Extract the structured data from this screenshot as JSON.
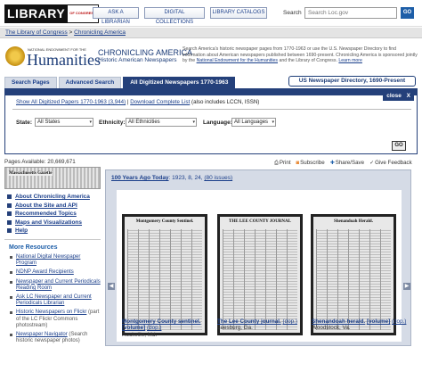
{
  "header": {
    "logo_word": "LIBRARY",
    "logo_sub": "OF CONGRESS",
    "buttons": [
      "ASK A LIBRARIAN",
      "DIGITAL COLLECTIONS",
      "LIBRARY CATALOGS"
    ],
    "search_label": "Search",
    "search_placeholder": "Search Loc.gov",
    "go_label": "GO"
  },
  "breadcrumb": [
    "The Library of Congress",
    ">",
    "Chronicling America"
  ],
  "banner": {
    "neh_small": "NATIONAL ENDOWMENT FOR THE",
    "neh_big": "Humanities",
    "title": "CHRONICLING AMERICA",
    "subtitle": "Historic American Newspapers",
    "desc_1": "Search America's historic newspaper pages from 1770-1963 or use the U.S. Newspaper Directory to find information about American newspapers published between 1690-present. Chronicling America is sponsored jointly by the",
    "desc_link_1": "National Endowment for the Humanities",
    "desc_2": "and the Library of Congress.",
    "desc_link_2": "Learn more"
  },
  "tabs": [
    "Search Pages",
    "Advanced Search",
    "All Digitized Newspapers 1770-1963"
  ],
  "directory_button": "US Newspaper Directory, 1690-Present",
  "panel": {
    "close_label": "close",
    "close_x": "X",
    "link_show_all": "Show All Digitized Papers 1770-1963 (3,944)",
    "separator": "|",
    "link_download": "Download Complete List",
    "download_note": "(also includes LCCN, ISSN)",
    "state_label": "State:",
    "state_value": "All States",
    "ethnicity_label": "Ethnicity:",
    "ethnicity_value": "All Ethnicities",
    "language_label": "Language:",
    "language_value": "All Languages",
    "go_label": "GO"
  },
  "pages_available": "Pages Available: 20,669,671",
  "share": [
    "Print",
    "Subscribe",
    "Share/Save",
    "Give Feedback"
  ],
  "sidebar": {
    "image_text": "Massachusetts Gazette",
    "nav": [
      "About Chronicling America",
      "About the Site and API",
      "Recommended Topics",
      "Maps and Visualizations",
      "Help"
    ],
    "more_heading": "More Resources",
    "resources": [
      {
        "link": "National Digital Newspaper Program",
        "note": ""
      },
      {
        "link": "NDNP Award Recipients",
        "note": ""
      },
      {
        "link": "Newspaper and Current Periodicals Reading Room",
        "note": ""
      },
      {
        "link": "Ask LC Newspaper and Current Periodicals Librarian",
        "note": ""
      },
      {
        "link": "Historic Newspapers on Flickr",
        "note": "(part of the LC Flickr Commons photostream)"
      },
      {
        "link": "Newspaper Navigator",
        "note": "(Search historic newspaper photos)"
      }
    ]
  },
  "hundred_years": {
    "title": "100 Years Ago Today",
    "date": ": 1923, 8, 24,",
    "issues": "(80 issues)",
    "papers": [
      {
        "masthead": "Montgomery County Sentinel.",
        "title": "Montgomery County sentinel.",
        "tail": "[volume]",
        "paren": "(dop.)",
        "loc": "Rockville, Md."
      },
      {
        "masthead": "THE LEE COUNTY JOURNAL",
        "title": "The Lee County journal.",
        "tail": "",
        "paren": "(dop.)",
        "loc": "Leesburg, Ga."
      },
      {
        "masthead": "Shenandoah Herald.",
        "title": "Shenandoah herald.",
        "tail": "[volume]",
        "paren": "(dop.)",
        "loc": "Woodstock, Va."
      }
    ],
    "prev": "◀",
    "next": "▶"
  }
}
